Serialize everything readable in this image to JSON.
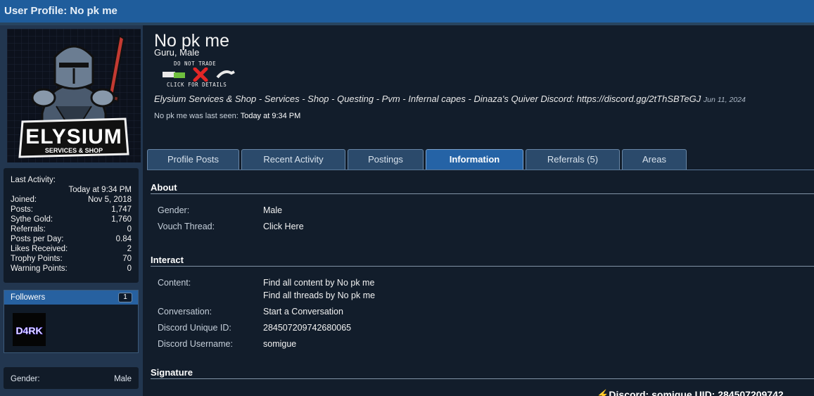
{
  "window": {
    "title": "User Profile: No pk me"
  },
  "avatar": {
    "brand": "ELYSIUM",
    "tagline": "SERVICES & SHOP"
  },
  "stats": [
    {
      "label": "Last Activity:",
      "value": ""
    },
    {
      "label": "",
      "value": "Today at 9:34 PM"
    },
    {
      "label": "Joined:",
      "value": "Nov 5, 2018"
    },
    {
      "label": "Posts:",
      "value": "1,747"
    },
    {
      "label": "Sythe Gold:",
      "value": "1,760"
    },
    {
      "label": "Referrals:",
      "value": "0"
    },
    {
      "label": "Posts per Day:",
      "value": "0.84"
    },
    {
      "label": "Likes Received:",
      "value": "2"
    },
    {
      "label": "Trophy Points:",
      "value": "70"
    },
    {
      "label": "Warning Points:",
      "value": "0"
    }
  ],
  "followers": {
    "title": "Followers",
    "count": "1",
    "avatar_text": "D4RK"
  },
  "sidebar_gender": {
    "label": "Gender:",
    "value": "Male"
  },
  "profile": {
    "name": "No pk me",
    "title": "Guru, Male",
    "badge_top": "DO NOT TRADE",
    "badge_bottom": "CLICK FOR DETAILS",
    "status": "Elysium Services & Shop - Services - Shop - Questing - Pvm - Infernal capes - Dinaza's Quiver Discord: https://discord.gg/2tThSBTeGJ",
    "status_date": "Jun 11, 2024",
    "last_seen_label": "No pk me was last seen:",
    "last_seen_value": "Today at 9:34 PM"
  },
  "tabs": [
    {
      "label": "Profile Posts",
      "active": false
    },
    {
      "label": "Recent Activity",
      "active": false
    },
    {
      "label": "Postings",
      "active": false
    },
    {
      "label": "Information",
      "active": true
    },
    {
      "label": "Referrals (5)",
      "active": false
    },
    {
      "label": "Areas",
      "active": false
    }
  ],
  "about": {
    "heading": "About",
    "gender_label": "Gender:",
    "gender_value": "Male",
    "vouch_label": "Vouch Thread:",
    "vouch_value": "Click Here"
  },
  "interact": {
    "heading": "Interact",
    "content_label": "Content:",
    "find_content": "Find all content by No pk me",
    "find_threads": "Find all threads by No pk me",
    "conversation_label": "Conversation:",
    "conversation_value": "Start a Conversation",
    "discord_id_label": "Discord Unique ID:",
    "discord_id_value": "284507209742680065",
    "discord_user_label": "Discord Username:",
    "discord_user_value": "somigue"
  },
  "signature": {
    "heading": "Signature",
    "text": "⚡Discord: somigue UID: 284507209742"
  },
  "colors": {
    "header_blue": "#1f5d9c",
    "tab_active": "#2563a6",
    "panel": "#121d2b"
  }
}
